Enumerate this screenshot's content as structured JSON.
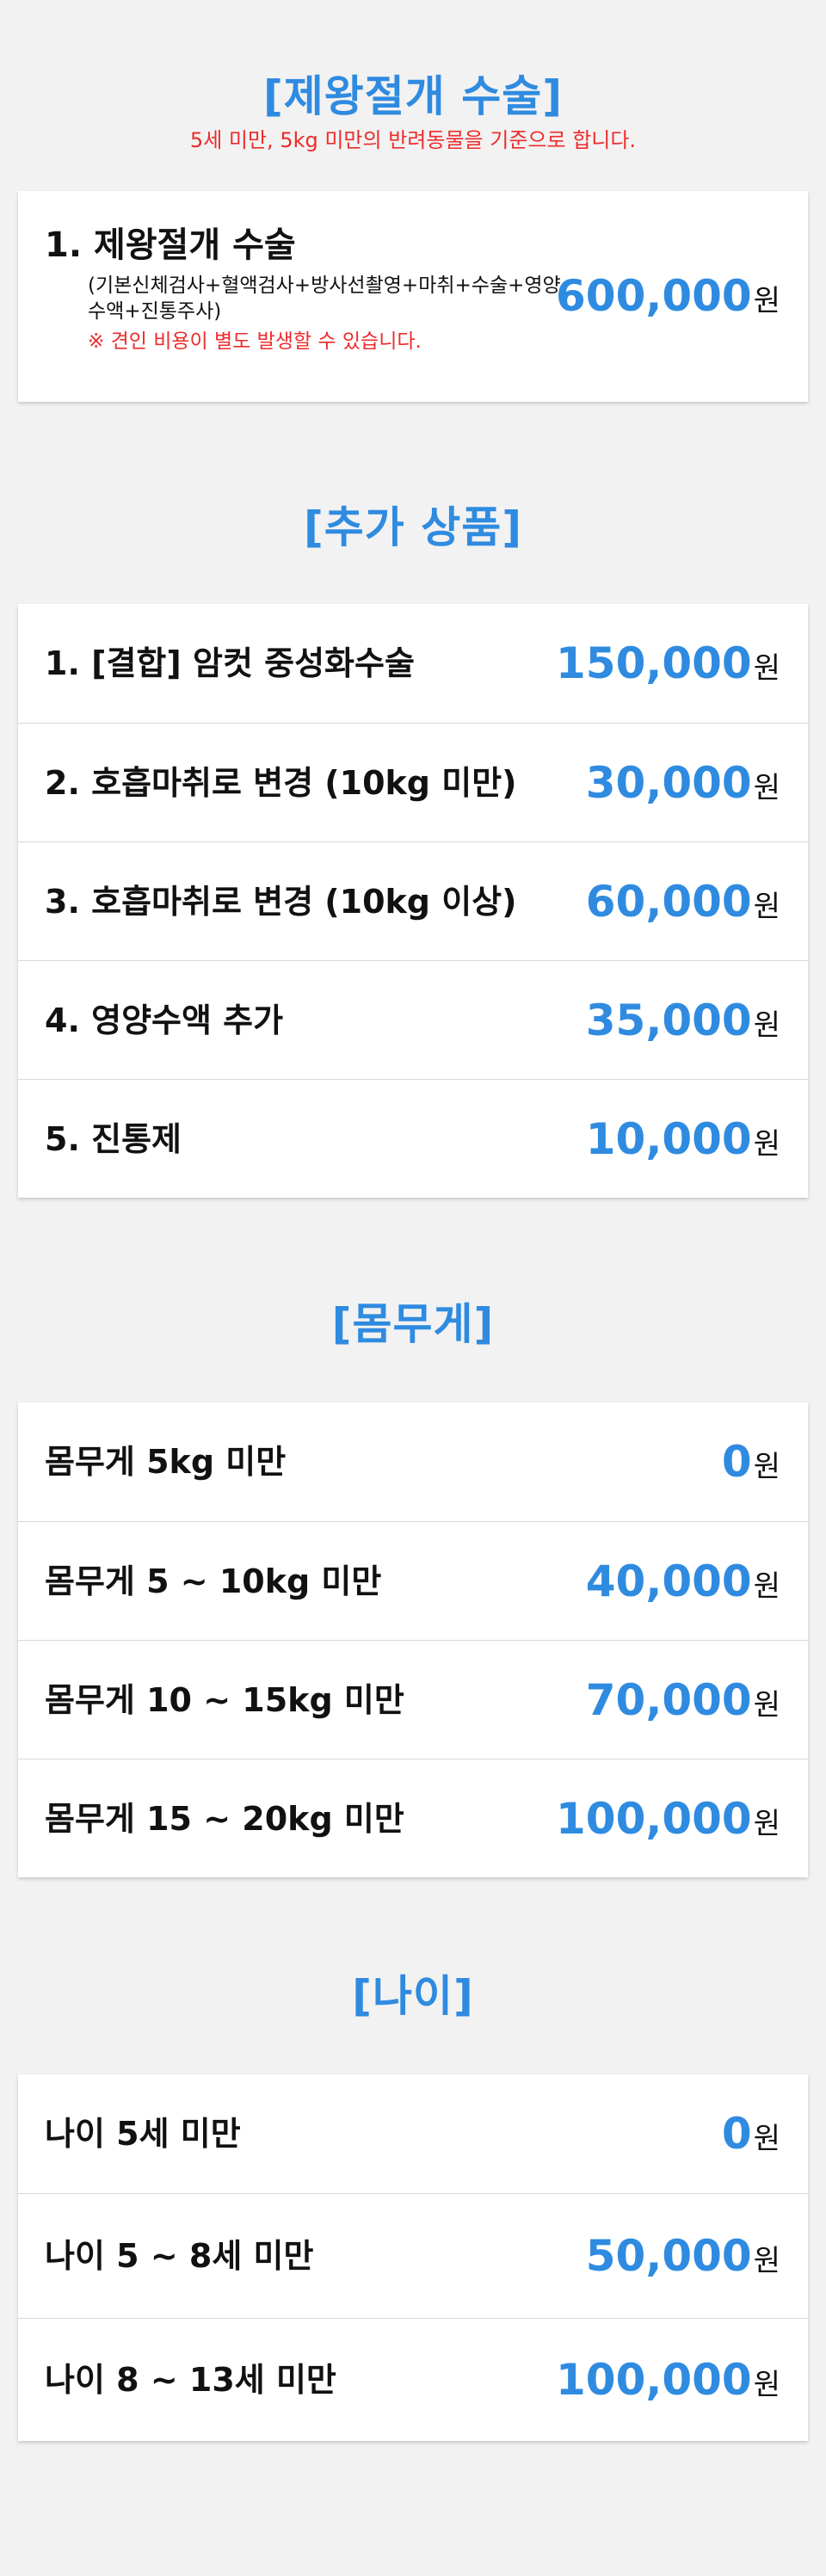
{
  "surgery": {
    "title": "[제왕절개 수술]",
    "subtitle": "5세 미만, 5kg 미만의 반려동물을 기준으로 합니다.",
    "item": {
      "label": "1. 제왕절개 수술",
      "detail": "(기본신체검사+혈액검사+방사선촬영+마취+수술+영양수액+진통주사)",
      "note": "※ 견인 비용이 별도 발생할 수 있습니다.",
      "price": "600,000",
      "unit": "원"
    }
  },
  "extras": {
    "title": "[추가 상품]",
    "items": [
      {
        "label": "1. [결합] 암컷 중성화수술",
        "price": "150,000",
        "unit": "원"
      },
      {
        "label": "2. 호흡마취로 변경 (10kg 미만)",
        "price": "30,000",
        "unit": "원"
      },
      {
        "label": "3. 호흡마취로 변경 (10kg 이상)",
        "price": "60,000",
        "unit": "원"
      },
      {
        "label": "4. 영양수액 추가",
        "price": "35,000",
        "unit": "원"
      },
      {
        "label": "5. 진통제",
        "price": "10,000",
        "unit": "원"
      }
    ]
  },
  "weight": {
    "title": "[몸무게]",
    "items": [
      {
        "label": "몸무게 5kg 미만",
        "price": "0",
        "unit": "원"
      },
      {
        "label": "몸무게 5 ~ 10kg 미만",
        "price": "40,000",
        "unit": "원"
      },
      {
        "label": "몸무게 10 ~ 15kg 미만",
        "price": "70,000",
        "unit": "원"
      },
      {
        "label": "몸무게 15 ~ 20kg 미만",
        "price": "100,000",
        "unit": "원"
      }
    ]
  },
  "age": {
    "title": "[나이]",
    "items": [
      {
        "label": "나이 5세 미만",
        "price": "0",
        "unit": "원"
      },
      {
        "label": "나이 5 ~ 8세 미만",
        "price": "50,000",
        "unit": "원"
      },
      {
        "label": "나이 8 ~ 13세 미만",
        "price": "100,000",
        "unit": "원"
      }
    ]
  },
  "colors": {
    "accent": "#2f8be0",
    "warning": "#ee2b2b",
    "background": "#f2f2f2",
    "card": "#ffffff"
  }
}
